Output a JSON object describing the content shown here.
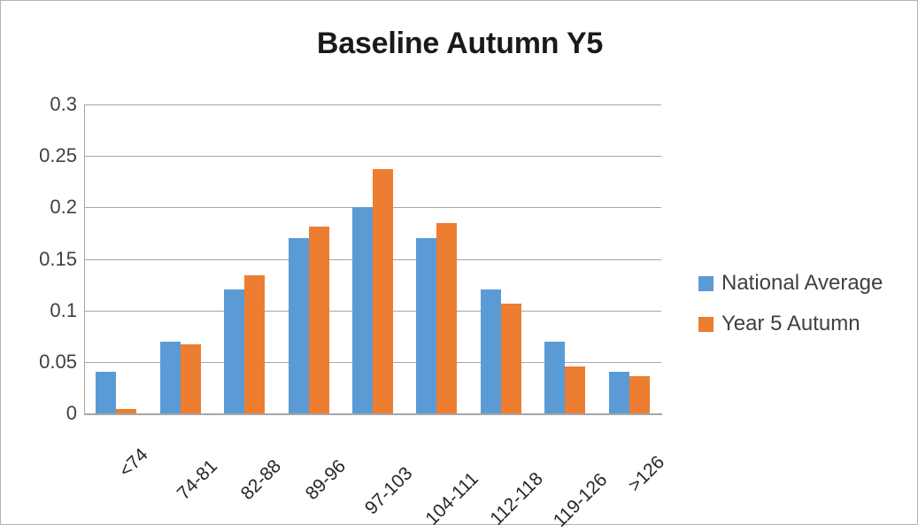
{
  "chart_data": {
    "type": "bar",
    "title": "Baseline Autumn Y5",
    "xlabel": "",
    "ylabel": "",
    "categories": [
      "<74",
      "74-81",
      "82-88",
      "89-96",
      "97-103",
      "104-111",
      "112-118",
      "119-126",
      ">126"
    ],
    "series": [
      {
        "name": "National Average",
        "color": "#5B9BD5",
        "values": [
          0.04,
          0.07,
          0.12,
          0.17,
          0.2,
          0.17,
          0.12,
          0.07,
          0.04
        ]
      },
      {
        "name": "Year 5 Autumn",
        "color": "#ED7D31",
        "values": [
          0.004,
          0.067,
          0.134,
          0.181,
          0.237,
          0.185,
          0.107,
          0.046,
          0.036
        ]
      }
    ],
    "ylim": [
      0,
      0.3
    ],
    "ytick_labels": [
      "0.3",
      "0.25",
      "0.2",
      "0.15",
      "0.1",
      "0.05",
      "0"
    ],
    "ytick_values": [
      0.3,
      0.25,
      0.2,
      0.15,
      0.1,
      0.05,
      0
    ],
    "grid": true,
    "grid_color": "#A6A6A6",
    "legend_position": "right",
    "xtick_rotation": -45,
    "plot_background": "#FFFFFF",
    "border_color": "#B3B3B3"
  }
}
